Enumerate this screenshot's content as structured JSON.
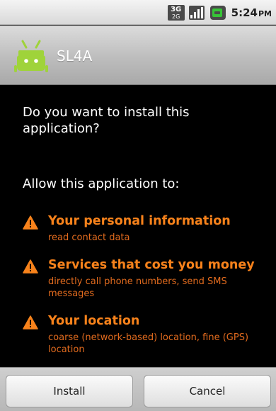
{
  "status_bar": {
    "network_type": "3G",
    "network_sub": "2G",
    "time": "5:24",
    "ampm": "PM"
  },
  "title_bar": {
    "app_name": "SL4A",
    "icon": "android-robot-icon"
  },
  "content": {
    "question": "Do you want to install this application?",
    "allow_label": "Allow this application to:",
    "permissions": [
      {
        "title": "Your personal information",
        "description": "read contact data"
      },
      {
        "title": "Services that cost you money",
        "description": "directly call phone numbers, send SMS messages"
      },
      {
        "title": "Your location",
        "description": "coarse (network-based) location, fine (GPS) location"
      }
    ]
  },
  "buttons": {
    "install": "Install",
    "cancel": "Cancel"
  },
  "colors": {
    "permission_accent": "#f7821b",
    "background": "#000000"
  }
}
